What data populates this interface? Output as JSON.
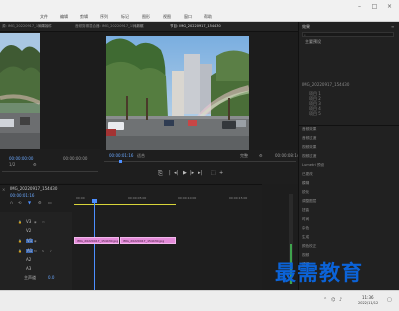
{
  "menu": [
    "文件",
    "编辑",
    "剪辑",
    "序列",
    "标记",
    "图形",
    "视图",
    "窗口",
    "帮助"
  ],
  "tabs": [
    {
      "label": "源: IMG_20220917_154430"
    },
    {
      "label": "效果控件"
    },
    {
      "label": "音频剪辑混合器: IMG_20220917_154430"
    },
    {
      "label": "元数据"
    },
    {
      "label": "节目: IMG_20220917_154430"
    }
  ],
  "left_monitor": {
    "timecode": "00:00:00:00",
    "fit": "1/2"
  },
  "program_monitor": {
    "timecode_left": "00:00:01:16",
    "fit": "适合",
    "quality": "完整",
    "timecode_right": "00:00:08:14"
  },
  "right_panel": {
    "title": "效果",
    "search_placeholder": "",
    "preset_title": "主要预设",
    "file_label": "IMG_20220917_154430",
    "effect_rows": [
      "音频效果",
      "音频过渡",
      "视频效果",
      "视频过渡",
      "Lumetri 预设",
      "已更改",
      "模糊",
      "锐化",
      "调整图层",
      "扭曲",
      "时间",
      "杂色",
      "生成",
      "颜色校正",
      "视频",
      "透视",
      "通道",
      "风格化"
    ],
    "list_items": [
      "项目 1",
      "项目 2",
      "项目 3",
      "项目 4",
      "项目 5"
    ]
  },
  "timeline": {
    "sequence_tab": "IMG_20220917_154430",
    "timecode": "00:00:01:16",
    "ruler_ticks": [
      "00:00",
      "00:00:05:00",
      "00:00:10:00",
      "00:00:15:00"
    ],
    "tracks": [
      "V3",
      "V2",
      "V1",
      "A1",
      "A2",
      "A3",
      "主声道"
    ],
    "clip_a": "IMG_20220917_154430.jpg",
    "clip_b": "IMG_20220917_154430.jpg",
    "master_value": "0.0"
  },
  "taskbar": {
    "time": "11:36",
    "date": "2022/11/12"
  },
  "watermark": "最需教育"
}
